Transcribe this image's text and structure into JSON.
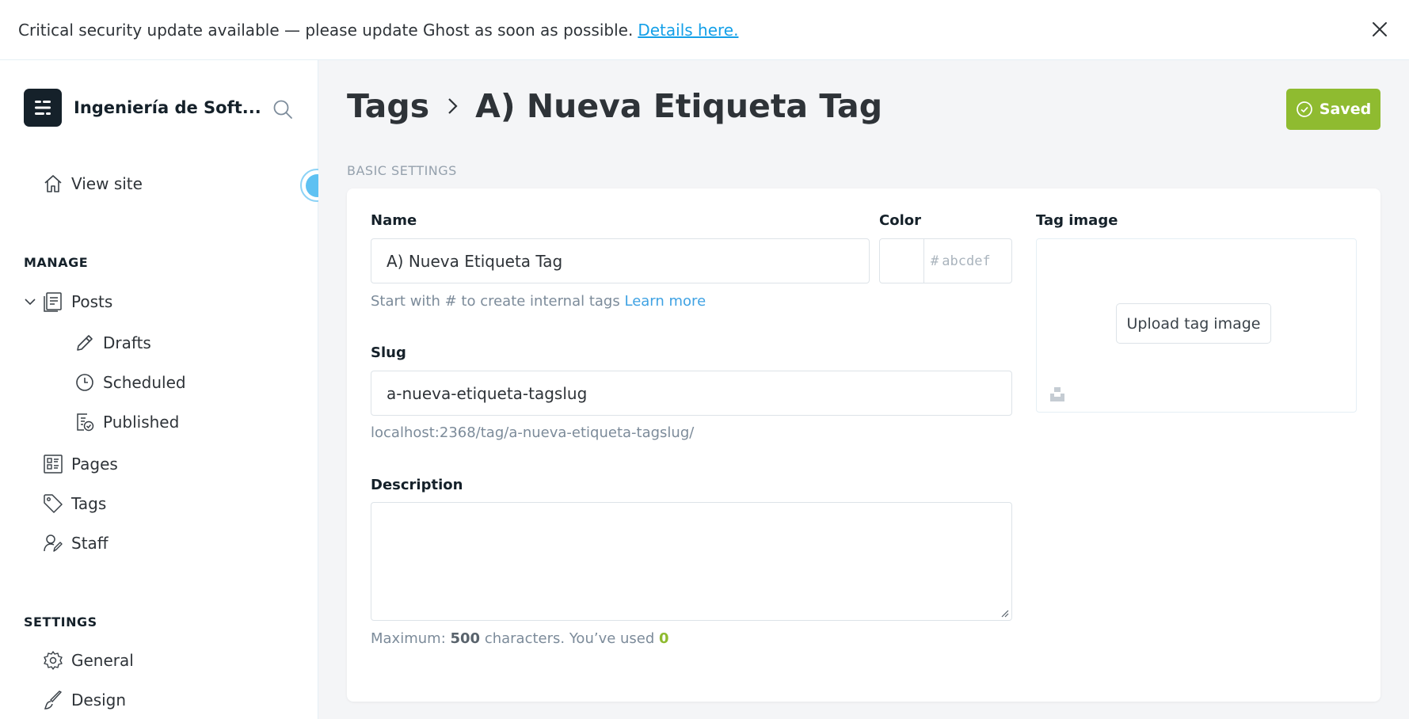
{
  "banner": {
    "text": "Critical security update available — please update Ghost as soon as possible.",
    "link": "Details here."
  },
  "sidebar": {
    "site_name": "Ingeniería de Soft...",
    "view_site": "View site",
    "manage_label": "MANAGE",
    "items": {
      "posts": "Posts",
      "drafts": "Drafts",
      "scheduled": "Scheduled",
      "published": "Published",
      "pages": "Pages",
      "tags": "Tags",
      "staff": "Staff"
    },
    "settings_label": "SETTINGS",
    "settings_items": {
      "general": "General",
      "design": "Design"
    }
  },
  "header": {
    "crumb_root": "Tags",
    "crumb_current": "A) Nueva Etiqueta Tag",
    "saved_label": "Saved"
  },
  "form": {
    "section_title": "BASIC SETTINGS",
    "name_label": "Name",
    "name_value": "A) Nueva Etiqueta Tag",
    "name_hint": "Start with # to create internal tags",
    "name_hint_link": "Learn more",
    "color_label": "Color",
    "color_hash": "#",
    "color_placeholder": "abcdef",
    "image_label": "Tag image",
    "upload_label": "Upload tag image",
    "slug_label": "Slug",
    "slug_value": "a-nueva-etiqueta-tagslug",
    "slug_url": "localhost:2368/tag/a-nueva-etiqueta-tagslug/",
    "description_label": "Description",
    "description_value": "",
    "max_prefix": "Maximum:",
    "max_value": "500",
    "max_mid": "characters. You’ve used",
    "used_value": "0"
  },
  "colors": {
    "accent": "#8fbb30",
    "link": "#14a0e8",
    "dark": "#15212a"
  }
}
